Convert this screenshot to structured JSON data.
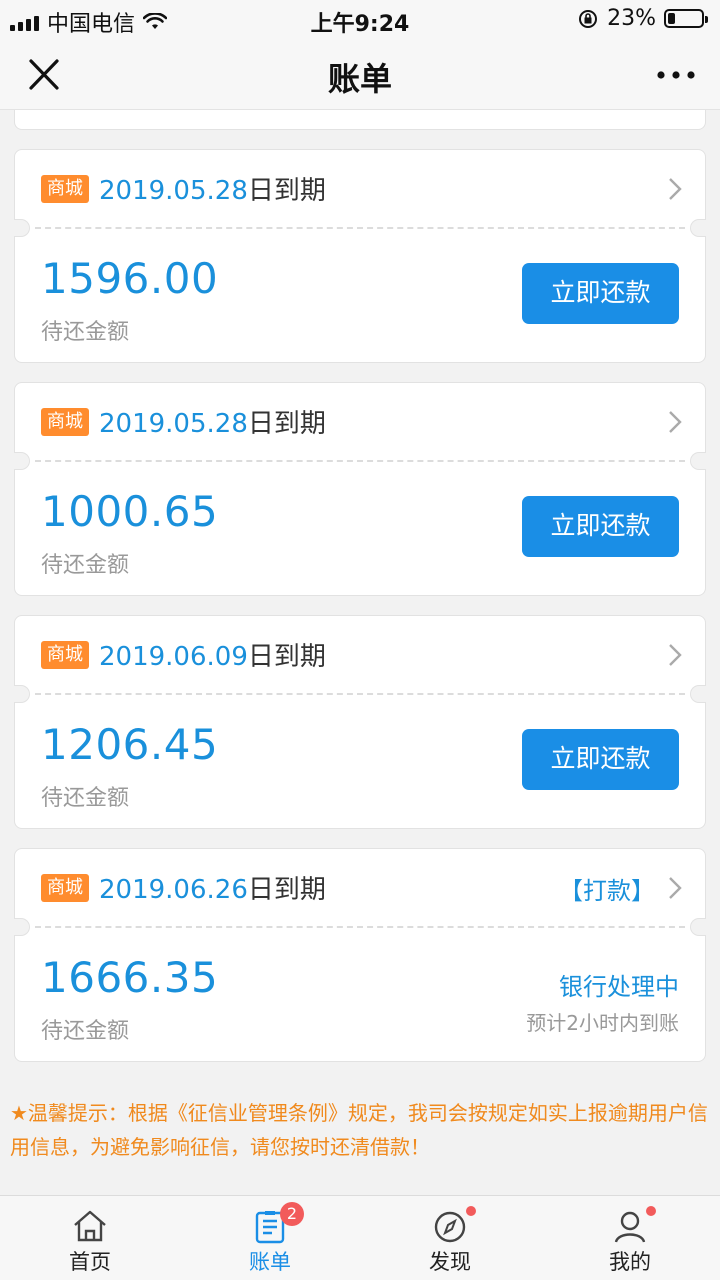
{
  "status_bar": {
    "carrier": "中国电信",
    "time": "上午9:24",
    "battery_pct": "23%",
    "battery_level": 0.23
  },
  "nav": {
    "title": "账单",
    "close_icon": "close-icon",
    "more_icon": "more-icon"
  },
  "colors": {
    "accent": "#1a8ee6",
    "tag_orange": "#ff8c2e",
    "notice_orange": "#f08a1e",
    "badge_red": "#f25b5b"
  },
  "bills": [
    {
      "tag": "商城",
      "date": "2019.05.28",
      "date_suffix": "日到期",
      "amount": "1596.00",
      "amount_label": "待还金额",
      "action": "立即还款"
    },
    {
      "tag": "商城",
      "date": "2019.05.28",
      "date_suffix": "日到期",
      "amount": "1000.65",
      "amount_label": "待还金额",
      "action": "立即还款"
    },
    {
      "tag": "商城",
      "date": "2019.06.09",
      "date_suffix": "日到期",
      "amount": "1206.45",
      "amount_label": "待还金额",
      "action": "立即还款"
    },
    {
      "tag": "商城",
      "date": "2019.06.26",
      "date_suffix": "日到期",
      "amount": "1666.35",
      "amount_label": "待还金额",
      "link": "【打款】",
      "status": "银行处理中",
      "status_note": "预计2小时内到账"
    }
  ],
  "notice": "★温馨提示：根据《征信业管理条例》规定，我司会按规定如实上报逾期用户信用信息，为避免影响征信，请您按时还清借款！",
  "tabs": [
    {
      "label": "首页",
      "icon": "home-icon"
    },
    {
      "label": "账单",
      "icon": "bill-icon",
      "badge": "2",
      "active": true
    },
    {
      "label": "发现",
      "icon": "compass-icon",
      "dot": true
    },
    {
      "label": "我的",
      "icon": "user-icon",
      "dot": true
    }
  ]
}
